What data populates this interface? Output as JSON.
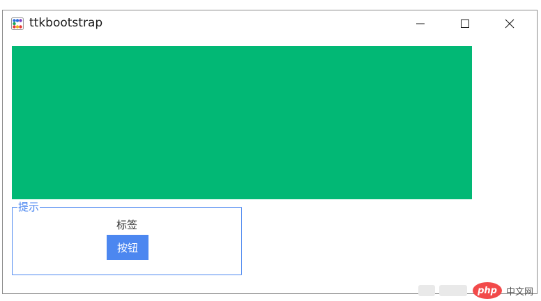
{
  "window": {
    "title": "ttkbootstrap",
    "app_icon": "ttkbootstrap-icon",
    "controls": {
      "minimize_icon": "minimize-icon",
      "maximize_icon": "maximize-icon",
      "close_icon": "close-icon"
    }
  },
  "canvas": {
    "fill_color": "#02b875"
  },
  "labelframe": {
    "title": "提示",
    "border_color": "#4c87f0",
    "label_text": "标签",
    "button_label": "按钮",
    "button_color": "#4c87f0"
  },
  "watermark": {
    "logo_text": "php",
    "site_text": "中文网"
  }
}
